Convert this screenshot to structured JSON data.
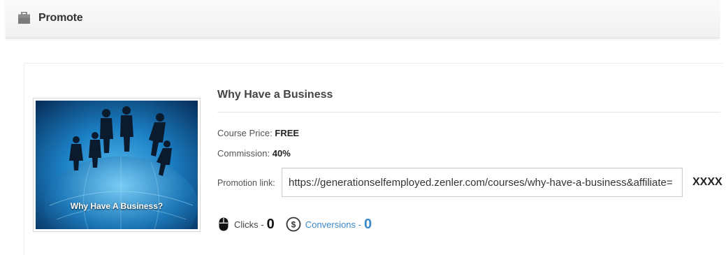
{
  "header": {
    "title": "Promote",
    "icon": "briefcase-icon"
  },
  "course": {
    "title": "Why Have a Business",
    "thumbnail_caption": "Why Have A Business?",
    "price_label": "Course Price:",
    "price_value": "FREE",
    "commission_label": "Commission:",
    "commission_value": "40%",
    "promotion_label": "Promotion link:",
    "promotion_link": "https://generationselfemployed.zenler.com/courses/why-have-a-business&affiliate=",
    "promotion_suffix": "XXXX"
  },
  "stats": {
    "clicks_icon": "mouse-icon",
    "clicks_label": "Clicks -",
    "clicks_count": "0",
    "conversions_icon": "dollar-circle-icon",
    "conversions_label": "Conversions -",
    "conversions_count": "0"
  },
  "colors": {
    "accent": "#3a87c8",
    "thumbnail_blue": "#0f6fb8"
  }
}
